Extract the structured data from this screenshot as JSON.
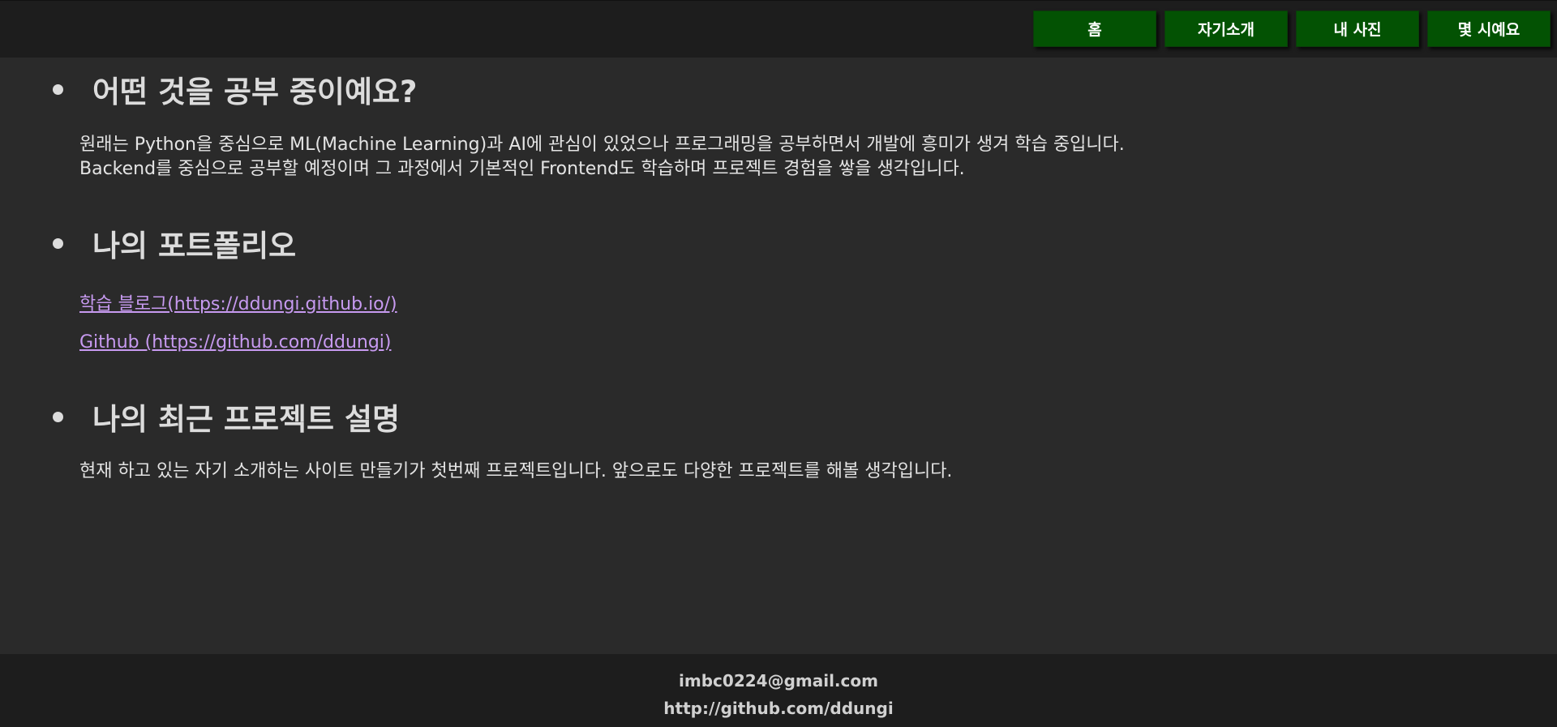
{
  "nav": {
    "items": [
      {
        "label": "홈"
      },
      {
        "label": "자기소개"
      },
      {
        "label": "내 사진"
      },
      {
        "label": "몇 시예요"
      }
    ]
  },
  "sections": [
    {
      "title": "어떤 것을 공부 중이예요?",
      "lines": [
        "원래는 Python을 중심으로 ML(Machine Learning)과 AI에 관심이 있었으나 프로그래밍을 공부하면서 개발에 흥미가 생겨 학습 중입니다.",
        "Backend를 중심으로 공부할 예정이며 그 과정에서 기본적인 Frontend도 학습하며 프로젝트 경험을 쌓을 생각입니다."
      ]
    },
    {
      "title": "나의 포트폴리오",
      "links": [
        "학습 블로그(https://ddungi.github.io/)",
        "Github (https://github.com/ddungi)"
      ]
    },
    {
      "title": "나의 최근 프로젝트 설명",
      "lines": [
        "현재 하고 있는 자기 소개하는 사이트 만들기가 첫번째 프로젝트입니다. 앞으로도 다양한 프로젝트를 해볼 생각입니다."
      ]
    }
  ],
  "footer": {
    "email": "imbc0224@gmail.com",
    "github": "http://github.com/ddungi"
  },
  "colors": {
    "nav_button_bg": "#035203",
    "link": "#c79af0",
    "background": "#2a2a2a",
    "bar": "#1d1d1d"
  }
}
